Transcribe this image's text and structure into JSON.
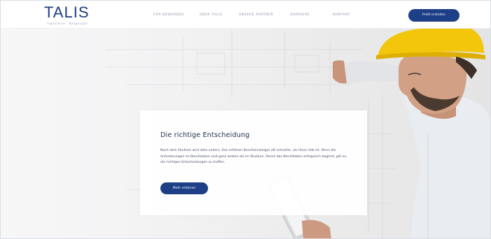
{
  "header": {
    "logo_text": "TALIS",
    "logo_tagline": "Ingenieure · Baugruppe",
    "nav": [
      {
        "label": "FÜR BEWERBER"
      },
      {
        "label": "ÜBER TALIS"
      },
      {
        "label": "UNSERE PARTNER"
      },
      {
        "label": "KARRIERE"
      },
      {
        "label": "KONTAKT"
      }
    ],
    "cta_label": "Profil erstellen"
  },
  "hero": {
    "title": "Die richtige Entscheidung",
    "text": "Nach dem Studium wird alles anders. Das erfahren Berufseinsteiger oft schneller, als ihnen lieb ist. Denn die Anforderungen im Berufsleben sind ganz andere als im Studium. Damit das Berufsleben erfolgreich beginnt, gilt es, die richtigen Entscheidungen zu treffen.",
    "button_label": "Mehr erfahren"
  },
  "colors": {
    "brand": "#1c3f86",
    "helmet": "#f3c60c"
  }
}
